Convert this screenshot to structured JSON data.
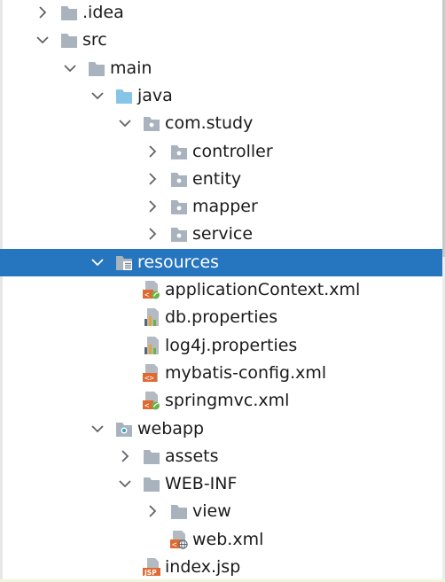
{
  "tree": {
    "nodes": [
      {
        "label": ".idea",
        "depth": 0,
        "state": "collapsed",
        "icon": "folder"
      },
      {
        "label": "src",
        "depth": 0,
        "state": "expanded",
        "icon": "folder"
      },
      {
        "label": "main",
        "depth": 1,
        "state": "expanded",
        "icon": "folder"
      },
      {
        "label": "java",
        "depth": 2,
        "state": "expanded",
        "icon": "source-folder"
      },
      {
        "label": "com.study",
        "depth": 3,
        "state": "expanded",
        "icon": "package"
      },
      {
        "label": "controller",
        "depth": 4,
        "state": "collapsed",
        "icon": "package"
      },
      {
        "label": "entity",
        "depth": 4,
        "state": "collapsed",
        "icon": "package"
      },
      {
        "label": "mapper",
        "depth": 4,
        "state": "collapsed",
        "icon": "package"
      },
      {
        "label": "service",
        "depth": 4,
        "state": "collapsed",
        "icon": "package"
      },
      {
        "label": "resources",
        "depth": 2,
        "state": "expanded",
        "icon": "resources-folder",
        "selected": true
      },
      {
        "label": "applicationContext.xml",
        "depth": 3,
        "state": "leaf",
        "icon": "spring-xml"
      },
      {
        "label": "db.properties",
        "depth": 3,
        "state": "leaf",
        "icon": "properties"
      },
      {
        "label": "log4j.properties",
        "depth": 3,
        "state": "leaf",
        "icon": "properties"
      },
      {
        "label": "mybatis-config.xml",
        "depth": 3,
        "state": "leaf",
        "icon": "xml"
      },
      {
        "label": "springmvc.xml",
        "depth": 3,
        "state": "leaf",
        "icon": "spring-xml"
      },
      {
        "label": "webapp",
        "depth": 2,
        "state": "expanded",
        "icon": "web-folder"
      },
      {
        "label": "assets",
        "depth": 3,
        "state": "collapsed",
        "icon": "folder"
      },
      {
        "label": "WEB-INF",
        "depth": 3,
        "state": "expanded",
        "icon": "folder"
      },
      {
        "label": "view",
        "depth": 4,
        "state": "collapsed",
        "icon": "folder"
      },
      {
        "label": "web.xml",
        "depth": 4,
        "state": "leaf",
        "icon": "web-xml"
      },
      {
        "label": "index.jsp",
        "depth": 3,
        "state": "leaf",
        "icon": "jsp"
      }
    ]
  },
  "colors": {
    "selection": "#2675bf",
    "folder": "#a9b3bd",
    "source_folder": "#86c4e8",
    "arrow": "#5f6368",
    "spring_leaf": "#6cb24a",
    "xml_orange": "#e0692f",
    "properties_bars": "#e8a230"
  }
}
